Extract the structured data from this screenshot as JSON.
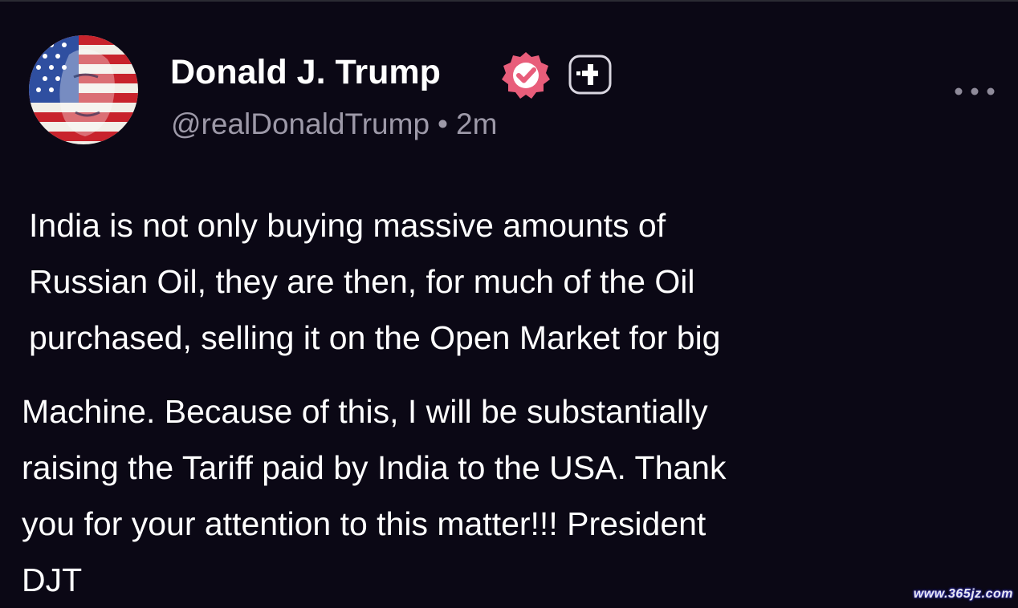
{
  "post": {
    "display_name": "Donald J. Trump",
    "handle": "@realDonaldTrump",
    "separator": "•",
    "time_ago": "2m",
    "icons": {
      "avatar": "avatar-flag-portrait",
      "verified": "verified-badge-icon",
      "follow": "follow-plus-icon",
      "more": "more-options-icon"
    },
    "body_lines_a": [
      "India is not only buying massive amounts of",
      "Russian Oil, they are then, for much of the Oil",
      "purchased, selling it on the Open Market for big"
    ],
    "body_lines_b": [
      "Machine. Because of this, I will be substantially",
      "raising the Tariff paid by India to the USA. Thank",
      "you for your attention to this matter!!! President",
      "DJT"
    ]
  },
  "colors": {
    "background": "#0b0815",
    "text": "#ffffff",
    "muted": "#9d99a8",
    "verified_badge": "#e85d7a"
  },
  "watermark": "www.365jz.com"
}
